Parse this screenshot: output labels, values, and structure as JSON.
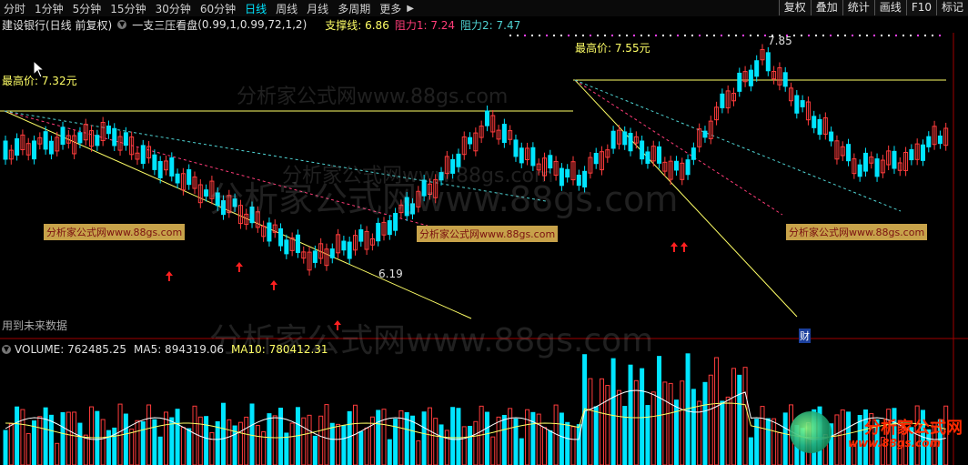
{
  "periods": [
    "分时",
    "1分钟",
    "5分钟",
    "15分钟",
    "30分钟",
    "60分钟",
    "日线",
    "周线",
    "月线",
    "多周期",
    "更多"
  ],
  "active_period": "日线",
  "right_buttons": [
    "复权",
    "叠加",
    "统计",
    "画线",
    "F10",
    "标记"
  ],
  "stock_title": "建设银行(日线 前复权)",
  "indicator": {
    "name": "一支三压看盘",
    "params": "(0.99,1,0.99,72,1,2)",
    "support": "支撑线: 6.86",
    "resist1": "阻力1: 7.24",
    "resist2": "阻力2: 7.47"
  },
  "price_labels": {
    "high_left": "最高价: 7.32元",
    "high_mid": "最高价: 7.55元",
    "peak": "7.85",
    "low": "6.19",
    "future": "用到未来数据",
    "cai": "财"
  },
  "volume": {
    "vol": "VOLUME: 762485.25",
    "ma5": "MA5: 894319.06",
    "ma10": "MA10: 780412.31"
  },
  "watermarks": {
    "main": "分析家公式网www.88gs.com",
    "box": "分析家公式网www.88gs.com",
    "logo": "分析家公式网",
    "logo_url": "www.88gs.com"
  },
  "colors": {
    "up": "#ff3c3c",
    "down": "#00e5ff",
    "support": "#ffff66",
    "resist1": "#ff3c78",
    "resist2": "#4fd3d3"
  }
}
